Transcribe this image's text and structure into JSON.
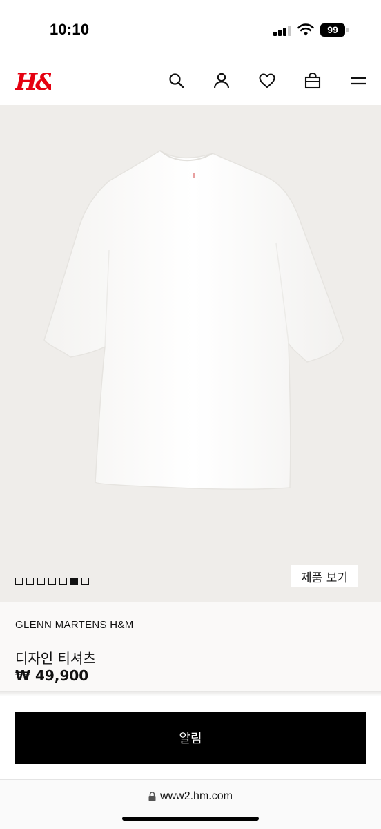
{
  "status_bar": {
    "time": "10:10",
    "battery": "99"
  },
  "header": {
    "logo_text": "H&M",
    "brand_color": "#e50010",
    "icons": [
      "search-icon",
      "account-icon",
      "heart-icon",
      "bag-icon",
      "menu-icon"
    ]
  },
  "gallery": {
    "image_count": 7,
    "active_index": 5,
    "view_product_label": "제품 보기"
  },
  "product": {
    "brand": "GLENN MARTENS H&M",
    "name": "디자인 티셔츠",
    "price": "₩ 49,900"
  },
  "cta": {
    "notify_label": "알림"
  },
  "browser": {
    "url": "www2.hm.com"
  }
}
